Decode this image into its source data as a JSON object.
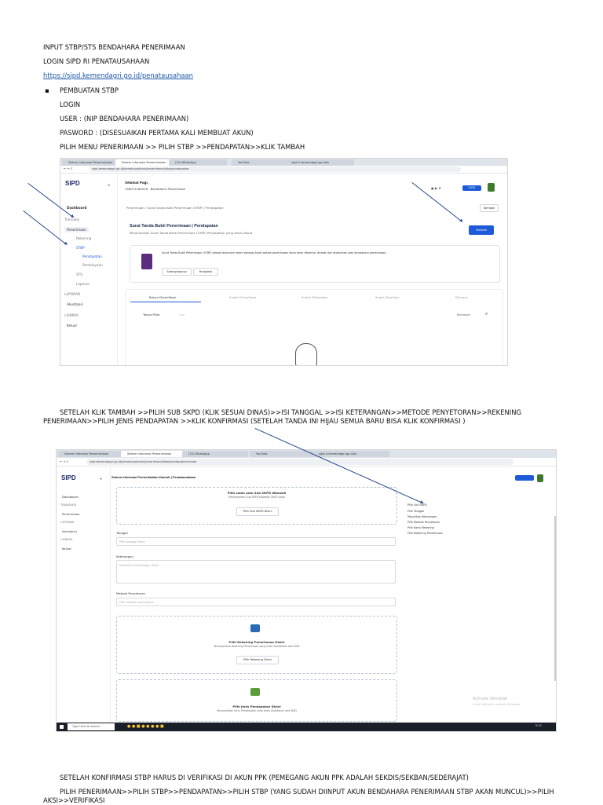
{
  "doc": {
    "line1": "INPUT STBP/STS BENDAHARA PENERIMAAN",
    "line2": "LOGIN SIPD RI PENATAUSAHAAN",
    "link": "https://sipd.kemendagri.go.id/penatausahaan",
    "bullet": "▪",
    "bullet_text": "PEMBUATAN STBP",
    "login": "LOGIN",
    "user": "USER : (NIP BENDAHARA PENERIMAAN)",
    "password": "PASWORD : (DISESUAIKAN PERTAMA KALI MEMBUAT AKUN)",
    "menu": "PILIH MENU PENERIMAAN >> PILIH STBP >>PENDAPATAN>>KLIK TAMBAH",
    "para2": "SETELAH KLIK TAMBAH >>PILIH SUB SKPD (KLIK SESUAI DINAS)>>ISI TANGGAL >>ISI KETERANGAN>>METODE PENYETORAN>>REKENING PENERIMAAN>>PILIH JENIS PENDAPATAN >>KLIK KONFIRMASI (SETELAH TANDA INI HIJAU SEMUA BARU BISA KLIK KONFIRMASI )",
    "para3": "SETELAH KONFIRMASI STBP HARUS DI VERIFIKASI DI AKUN PPK (PEMEGANG AKUN PPK ADALAH SEKDIS/SEKBAN/SEDERAJAT)",
    "para4": "PILIH PENERIMAAN>>PILIH STBP>>PENDAPATAN>>PILIH STBP (YANG SUDAH DIINPUT AKUN BENDAHARA PENERIMAAN STBP AKAN MUNCUL)>>PILIH AKSI>>VERIFIKASI"
  },
  "shot1": {
    "tabs": [
      "Sistem Informasi Pemerintahan",
      "Sistem Informasi Pemerintahan",
      "(32) WhatsApp",
      "YouTube",
      "sipd-ri.kemendagri.go.id/in"
    ],
    "url": "sipd.kemendagri.go.id/penatausahaan/penerimaan/stbp/pendapatan",
    "logo": "SIPD",
    "greeting": "Selamat Pagi,",
    "user_sub": "199011182016 · Bendahara Penerimaan",
    "year_badge": "2025",
    "menu": {
      "dashboard": "Dashboard",
      "section_transaksi": "Transaksi",
      "penerimaan": "Penerimaan",
      "rekening": "Rekening",
      "stbp": "STBP",
      "pendapatan": "Pendapatan",
      "pembiayaan": "Pembiayaan",
      "sts": "STS",
      "laporan_sub": "Laporan",
      "section_laporan": "LAPORAN",
      "akuntansi": "Akuntansi",
      "section_lainnya": "LAINNYA",
      "keluar": "Keluar"
    },
    "breadcrumb": "Penerimaan  /  Surat Tanda Bukti Penerimaan (STBP)  /  Pendapatan",
    "kembali": "Kembali",
    "title": "Surat Tanda Bukti Penerimaan | Pendapatan",
    "subtitle": "Menampilkan Surat Tanda Bukti Penerimaan (STBP) Pendapatan yang telah dibuat",
    "tambah": "Tambah",
    "info_text": "Surat Tanda Bukti Penerimaan (STBP) adalah dokumen resmi sebagai bukti bahwa penerimaan dana telah diterima, dicatat dan disetorkan oleh bendahara penerimaan.",
    "info_btn1": "Selengkapnya",
    "info_btn2": "Helpdesk",
    "tabs_status": [
      "Belum Diverifikasi",
      "Sudah Diverifikasi",
      "Sudah Dibatalkan",
      "Sudah Disahkan",
      "Dihapus"
    ],
    "filter": "Tanpa Filter",
    "search": "Cari",
    "search_label": "Berdasar"
  },
  "shot2": {
    "tabs": [
      "Sistem Informasi Pemerintahan",
      "Sistem Informasi Pemerintahan",
      "(32) WhatsApp",
      "YouTube",
      "sipd-ri.kemendagri.go.id/in"
    ],
    "url": "sipd.kemendagri.go.id/penatausahaan/penerimaan/stbp/pendapatan/create",
    "logo": "SIPD",
    "header_title": "Sistem Informasi Pemerintahan Daerah | Penatausahaan",
    "menu": {
      "dashboard": "Dashboard",
      "section_transaksi": "TRANSAKSI",
      "penerimaan": "Penerimaan",
      "section_laporan": "LAPORAN",
      "akuntansi": "Akuntansi",
      "section_lainnya": "LAINNYA",
      "keluar": "Keluar"
    },
    "pilih_skpd_title": "Pilih salah satu Sub SKPD dibawah",
    "pilih_skpd_sub": "Menampilkan Sub SKPD Dibawah SKPD Anda",
    "pilih_skpd_btn": "Pilih Sub SKPD Disini",
    "tanggal_label": "Tanggal",
    "tanggal_placeholder": "Pilih tanggal disini",
    "keterangan_label": "Keterangan",
    "keterangan_placeholder": "Masukkan keterangan disini",
    "metode_label": "Metode Penyetoran",
    "metode_placeholder": "Pilih metode penyetoran",
    "rekening_title": "Pilih Rekening Penerimaan Disini",
    "rekening_sub": "Menampilkan Rekening Penerimaan yang telah disediakan oleh BUD",
    "rekening_btn": "Pilih Rekening Disini",
    "jenis_title": "Pilih Jenis Pendapatan Disini",
    "jenis_sub": "Menampilkan Jenis Pendapatan yang telah disediakan oleh BUD",
    "checklist": [
      "Pilih Sub SKPD",
      "Pilih Tanggal",
      "Masukkan Keterangan",
      "Pilih Metode Penyetoran",
      "Pilih Kartu Rekening",
      "Pilih Rekening Penerimaan"
    ],
    "watermark1": "Activate Windows",
    "watermark2": "Go to Settings to activate Windows.",
    "taskbar_search": "Type here to search",
    "clock": "9:51"
  }
}
